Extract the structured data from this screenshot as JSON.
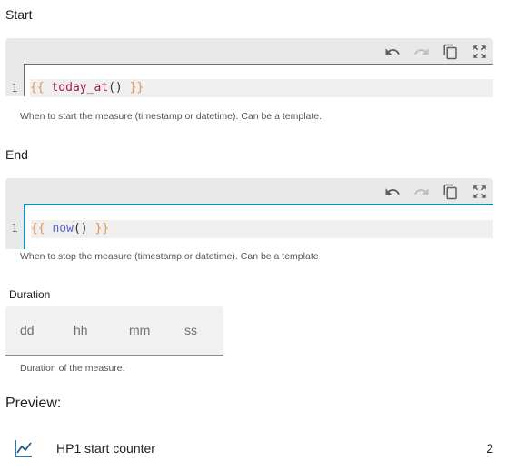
{
  "start": {
    "label": "Start",
    "line_number": "1",
    "code": {
      "open": "{{ ",
      "fn": "today_at",
      "args": "()",
      "close": " }}"
    },
    "helper": "When to start the measure (timestamp or datetime). Can be a template."
  },
  "end": {
    "label": "End",
    "line_number": "1",
    "code": {
      "open": "{{ ",
      "fn": "now",
      "args": "()",
      "close": " }}"
    },
    "helper": "When to stop the measure (timestamp or datetime). Can be a template"
  },
  "toolbar": {
    "icons": [
      "undo-icon",
      "redo-icon",
      "copy-icon",
      "fullscreen-icon"
    ]
  },
  "duration": {
    "label": "Duration",
    "fields": {
      "dd": "dd",
      "hh": "hh",
      "mm": "mm",
      "ss": "ss"
    },
    "helper": "Duration of the measure."
  },
  "preview": {
    "label": "Preview:",
    "entity_name": "HP1 start counter",
    "entity_value": "2",
    "icon": "chart-line-icon"
  },
  "colors": {
    "focus_accent": "#0b92b8",
    "brace": "#e4934a",
    "fn_today": "#a11b52",
    "fn_now": "#5a61d4",
    "chart_icon": "#1f5f8c"
  }
}
